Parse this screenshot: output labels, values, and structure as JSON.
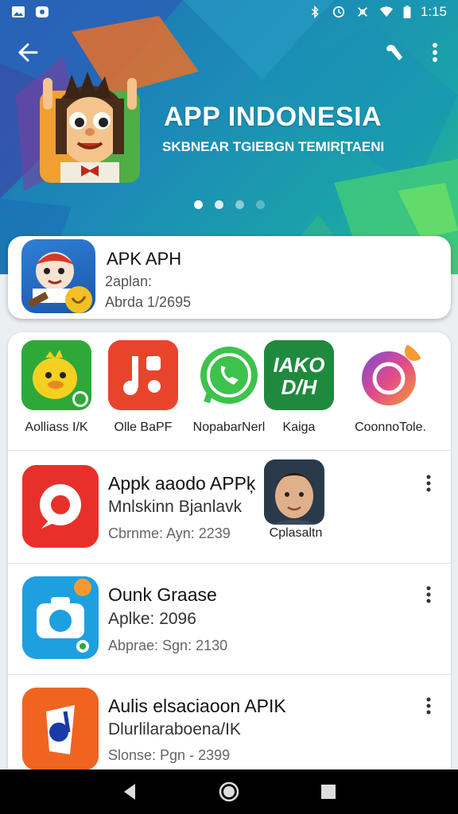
{
  "status_bar": {
    "time": "1:15",
    "icons_left": [
      "image-icon",
      "notification-icon"
    ],
    "icons_right": [
      "bluetooth-icon",
      "alarm-icon",
      "vibrate-icon",
      "wifi-icon",
      "battery-icon"
    ]
  },
  "hero": {
    "title": "APP INDONESIA",
    "subtitle": "SKBNEAR TGIEBGN TEMIR[TAENI",
    "carousel_pages": 4,
    "carousel_active": 1
  },
  "featured": {
    "title": "APK APH",
    "line1": "2aplan:",
    "line2": "Abrda 1/2695"
  },
  "top_apps": [
    {
      "label": "Aolliass I/K",
      "icon": "duck-icon",
      "color": "#2fa83a"
    },
    {
      "label": "Olle BaPF",
      "icon": "music-note-icon",
      "color": "#e8442c"
    },
    {
      "label": "NopabarNerl",
      "icon": "whatsapp-icon",
      "color": "#ffffff"
    },
    {
      "label": "Kaiga",
      "icon_text": "IAKO D/H",
      "icon": "text-logo-icon",
      "color": "#1f8a3e"
    },
    {
      "label": "CoonnoTole.",
      "icon": "ring-icon",
      "color": "#ffffff"
    }
  ],
  "list": [
    {
      "title": "Appk aaodo APPķ",
      "line2": "Mnlskinn Bjanlavk",
      "line3": "Cbrnme: Ayn: 2239",
      "icon": "red-logo-icon",
      "extra_label": "Cplasaltn"
    },
    {
      "title": "Ounk Graase",
      "line2": "Aplke: 2096",
      "line3": "Abprae: Sgn: 2130",
      "icon": "camera-icon"
    },
    {
      "title": "Aulis elsaciaoon APIK",
      "line2": "Dlurlilaraboena/IK",
      "line3": "Slonse: Pgn - 2399",
      "icon": "orange-logo-icon"
    }
  ],
  "colors": {
    "hero_start": "#1f6fb0",
    "hero_end": "#2fbf88",
    "background": "#eceff1"
  }
}
